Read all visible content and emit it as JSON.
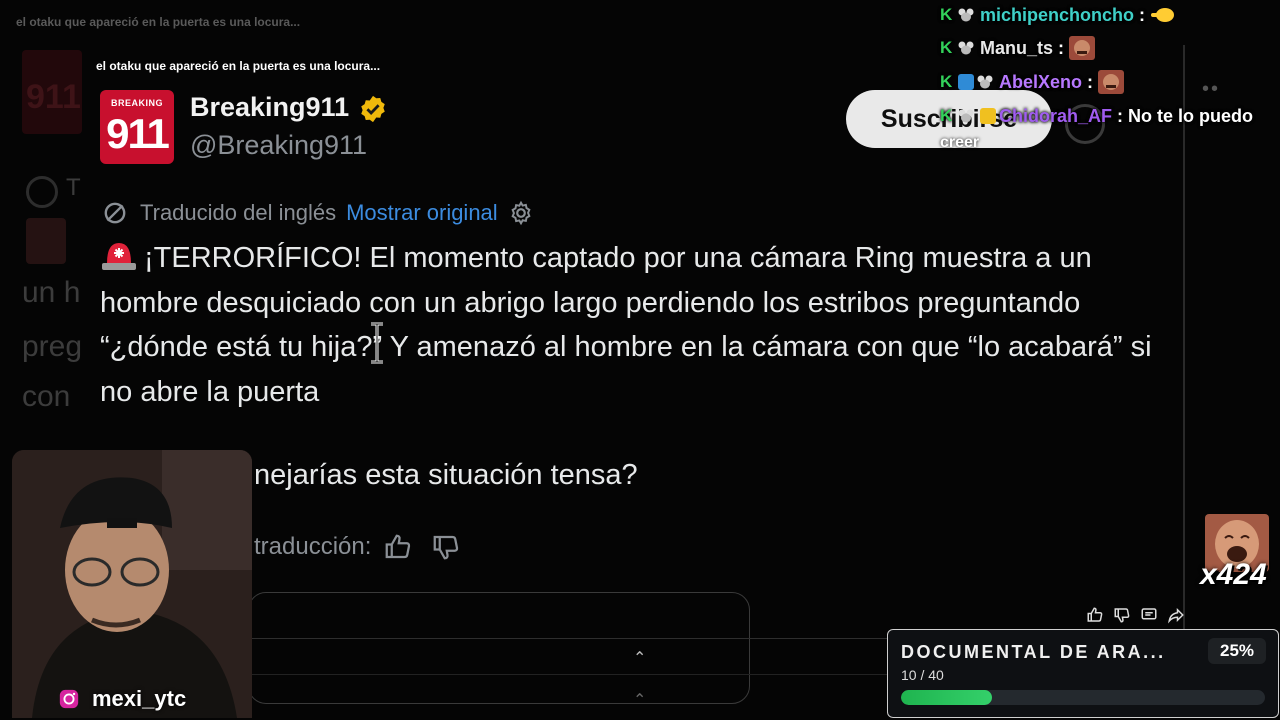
{
  "video_title": "el otaku que apareció en la puerta es una locura...",
  "background": {
    "caption": "el otaku que apareció en la puerta es una locura...",
    "logo_text": "911",
    "partial_lines": [
      "T",
      "un h",
      "preg",
      "con"
    ]
  },
  "tweet": {
    "avatar_small": "BREAKING",
    "avatar_big": "911",
    "display_name": "Breaking911",
    "handle": "@Breaking911",
    "translated_from": "Traducido del inglés",
    "show_original": "Mostrar original",
    "body": "¡TERRORÍFICO! El momento captado por una cámara Ring muestra a un hombre desquiciado con un abrigo largo perdiendo los estribos preguntando “¿dónde está tu hija?” Y amenazó al hombre en la cámara con que “lo acabará” si no abre la puerta",
    "question": "nejarías esta situación tensa?",
    "rate_label": "traducción:"
  },
  "youtube": {
    "subscribe_label": "Suscribirse"
  },
  "chat": [
    {
      "user": "michipenchoncho",
      "color": "#3fd0c8",
      "text": "",
      "emote": "hand-emote",
      "badges": [
        "kick-badge",
        "mouse-badge"
      ]
    },
    {
      "user": "Manu_ts",
      "color": "#e8e8e8",
      "text": "",
      "emote": "face-emote",
      "badges": [
        "kick-badge",
        "mouse-badge"
      ]
    },
    {
      "user": "AbelXeno",
      "color": "#b778ff",
      "text": "",
      "emote": "face-emote",
      "badges": [
        "kick-badge",
        "blue-badge",
        "mouse-badge"
      ]
    },
    {
      "user": "Chidorah_AF",
      "color": "#a05cf0",
      "text": "No te lo puedo",
      "emote": "",
      "badges": [
        "kick-badge",
        "mouse-badge",
        "yellow-badge"
      ]
    }
  ],
  "chat_continuation": "creer",
  "webcam": {
    "username": "mexi_ytc",
    "icon": "instagram-icon"
  },
  "combo": {
    "count": "x424"
  },
  "goal": {
    "title": "DOCUMENTAL DE ARA...",
    "percent_label": "25%",
    "percent": 0.25,
    "count": "10 / 40"
  },
  "colors": {
    "link": "#3c8ce0",
    "verified": "#f0b90b",
    "brand_red": "#c8102e",
    "progress": "#2ec463"
  }
}
